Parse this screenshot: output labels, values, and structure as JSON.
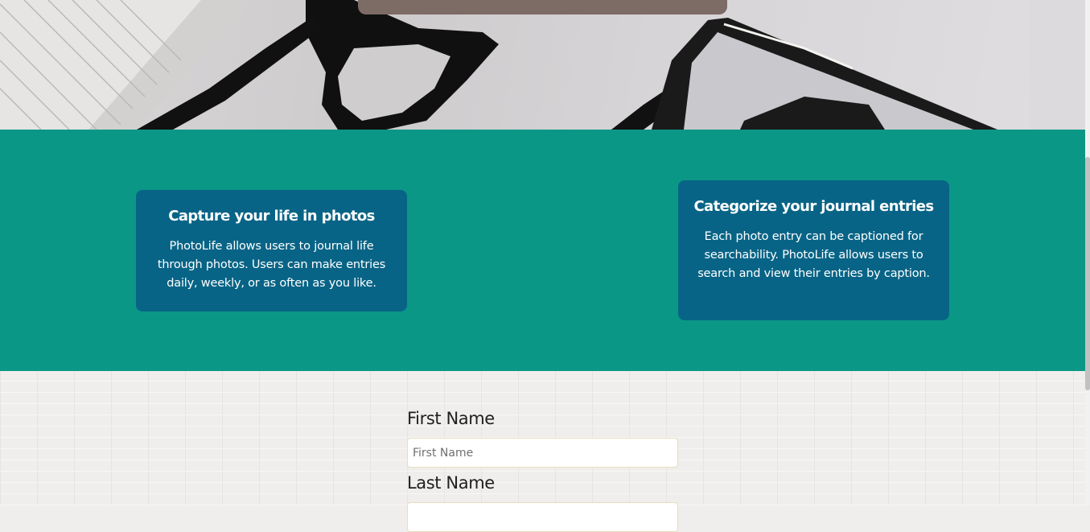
{
  "hero": {
    "image": "notebook-glasses-phone-photo"
  },
  "features": {
    "cards": [
      {
        "title": "Capture your life in photos",
        "text": "PhotoLife allows users to journal life through photos. Users can make entries daily, weekly, or as often as you like."
      },
      {
        "title": "Categorize your journal entries",
        "text": "Each photo entry can be captioned for searchability. PhotoLife allows users to search and view their entries by caption."
      }
    ]
  },
  "form": {
    "first_name": {
      "label": "First Name",
      "placeholder": "First Name",
      "value": ""
    },
    "last_name": {
      "label": "Last Name",
      "placeholder": "",
      "value": ""
    }
  },
  "colors": {
    "features_bg": "#0b9786",
    "card_bg": "#086486",
    "overlay": "#7d6b66"
  }
}
